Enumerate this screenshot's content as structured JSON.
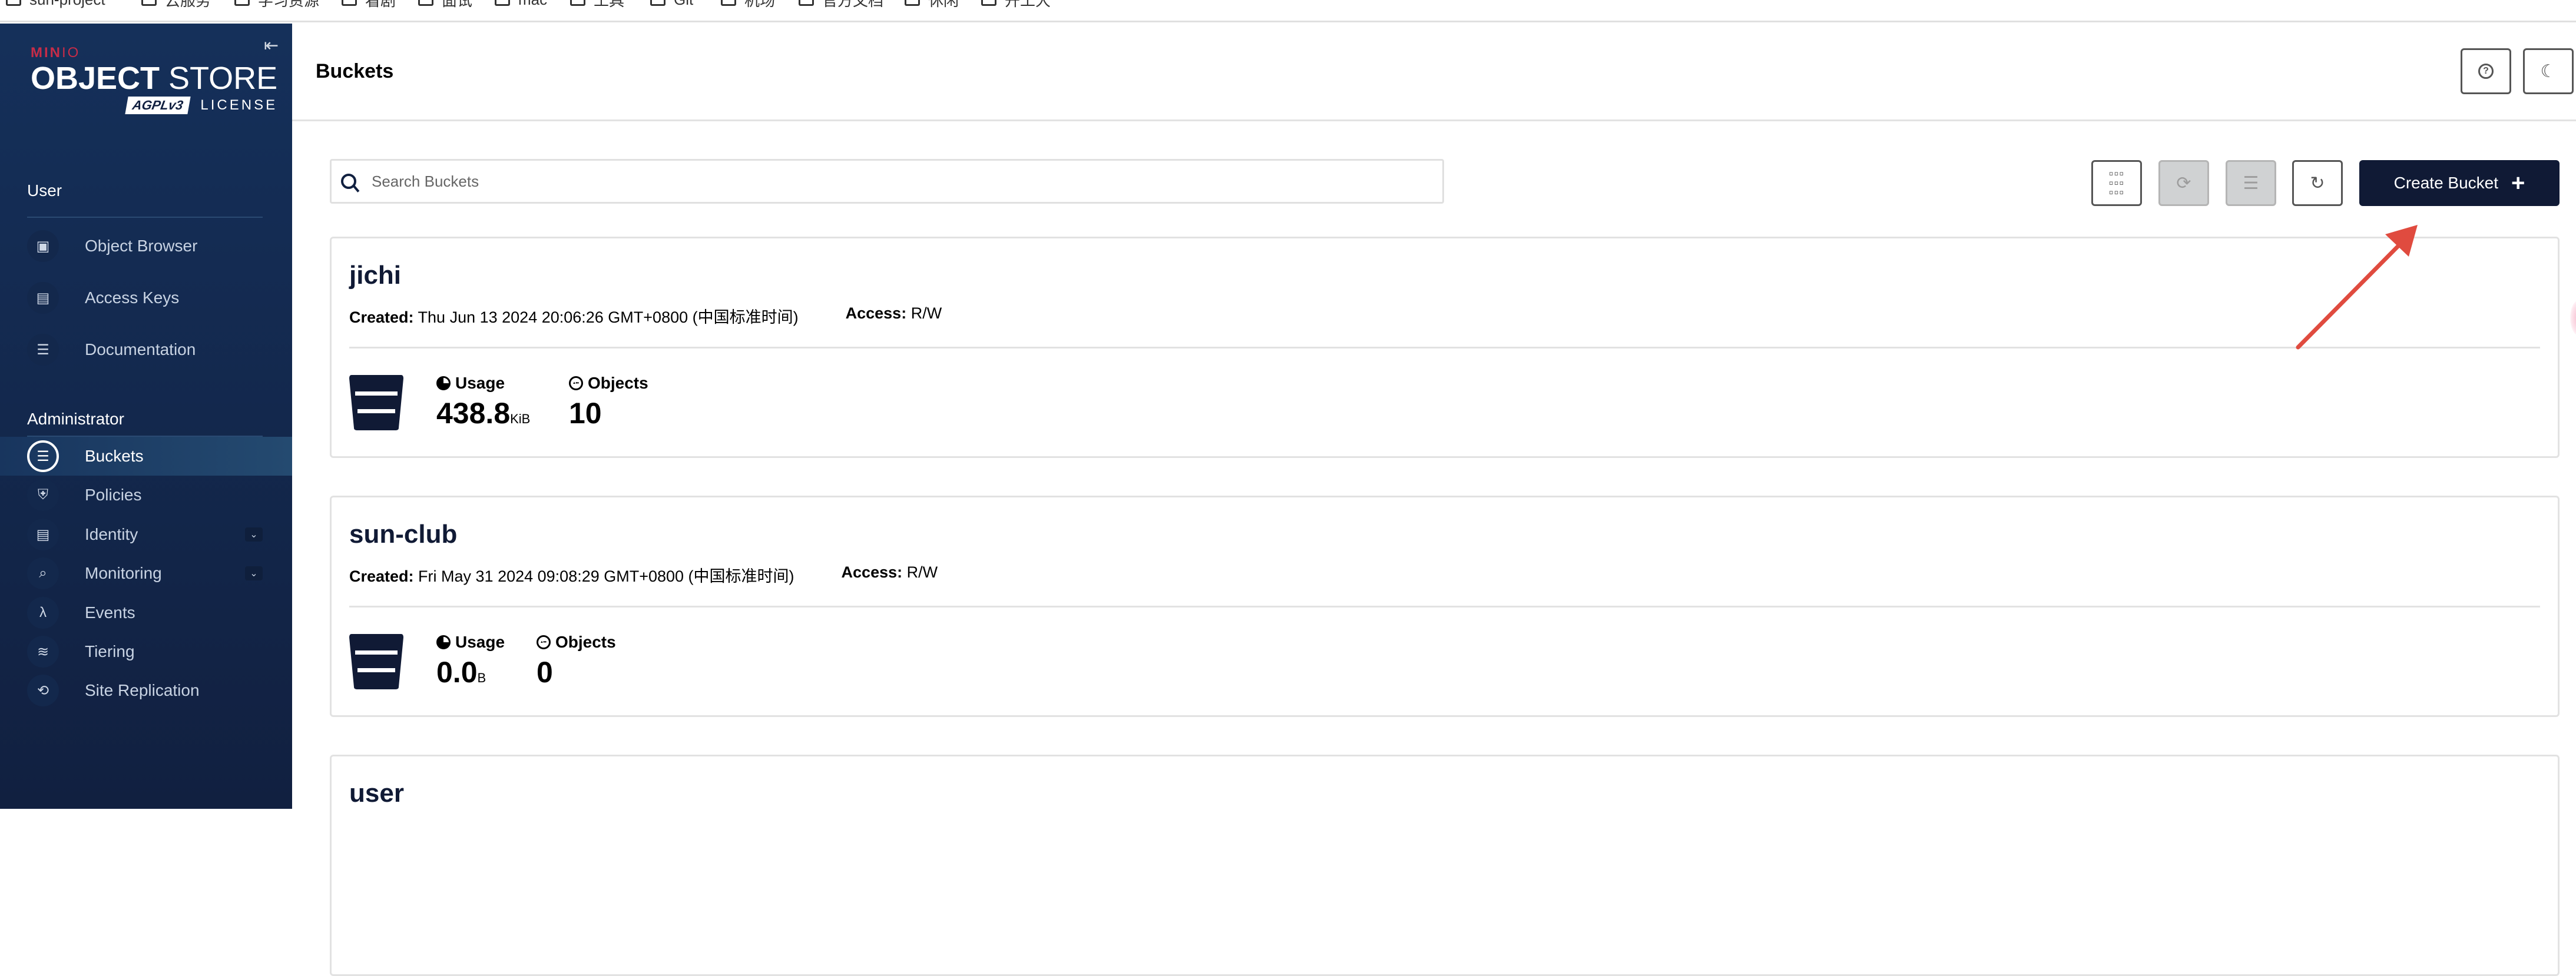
{
  "bookmarks": [
    "sun-project",
    "云服务",
    "学习资源",
    "看剧",
    "面试",
    "mac",
    "工具",
    "Git",
    "机场",
    "官方文档",
    "休闲",
    "开工大"
  ],
  "brand": {
    "minio": "MIN",
    "minio_suffix": "IO",
    "product_bold": "OBJECT",
    "product_light": " STORE",
    "agpl": "AGPLv3",
    "license": "LICENSE",
    "accent_color": "#c72c48"
  },
  "sidebar": {
    "collapse_icon": "collapse-left-icon",
    "sections": [
      {
        "title": "User",
        "items": [
          {
            "label": "Object Browser",
            "icon": "object-browser-icon"
          },
          {
            "label": "Access Keys",
            "icon": "access-keys-icon"
          },
          {
            "label": "Documentation",
            "icon": "documentation-icon"
          }
        ]
      },
      {
        "title": "Administrator",
        "items": [
          {
            "label": "Buckets",
            "icon": "bucket-icon",
            "active": true
          },
          {
            "label": "Policies",
            "icon": "policies-icon"
          },
          {
            "label": "Identity",
            "icon": "identity-icon",
            "expandable": true
          },
          {
            "label": "Monitoring",
            "icon": "monitoring-icon",
            "expandable": true
          },
          {
            "label": "Events",
            "icon": "lambda-icon"
          },
          {
            "label": "Tiering",
            "icon": "tiering-icon"
          },
          {
            "label": "Site Replication",
            "icon": "site-replication-icon"
          }
        ]
      }
    ]
  },
  "header": {
    "title": "Buckets",
    "help_icon": "help-icon",
    "theme_icon": "dark-mode-icon"
  },
  "toolbar": {
    "search_placeholder": "Search Buckets",
    "search_value": "",
    "select_multiple_icon": "grid-icon",
    "replication_icon": "replication-icon",
    "delete_icon": "delete-buckets-icon",
    "refresh_icon": "refresh-icon",
    "create_label": "Create Bucket",
    "create_icon": "plus-icon"
  },
  "buckets": [
    {
      "name": "jichi",
      "created_label": "Created:",
      "created": "Thu Jun 13 2024 20:06:26 GMT+0800 (中国标准时间)",
      "access_label": "Access:",
      "access": "R/W",
      "usage_label": "Usage",
      "usage_value": "438.8",
      "usage_unit": "KiB",
      "objects_label": "Objects",
      "objects_value": "10"
    },
    {
      "name": "sun-club",
      "created_label": "Created:",
      "created": "Fri May 31 2024 09:08:29 GMT+0800 (中国标准时间)",
      "access_label": "Access:",
      "access": "R/W",
      "usage_label": "Usage",
      "usage_value": "0.0",
      "usage_unit": "B",
      "objects_label": "Objects",
      "objects_value": "0"
    },
    {
      "name": "user"
    }
  ],
  "annotation": {
    "type": "arrow",
    "color": "#e04b3f",
    "target": "create-bucket-button"
  }
}
